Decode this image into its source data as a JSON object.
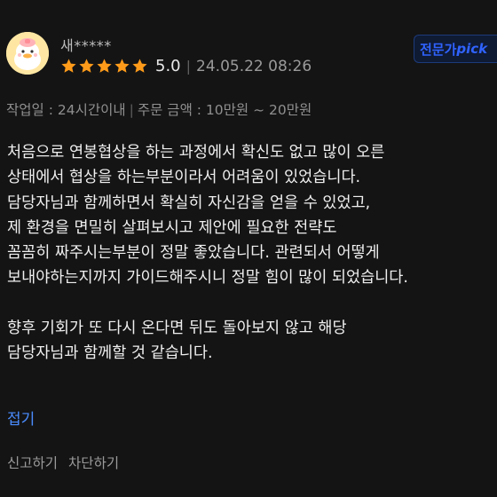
{
  "header": {
    "reviewer_name": "새*****",
    "rating_value": 5,
    "rating_text": "5.0",
    "date": "24.05.22 08:26",
    "badge": {
      "prefix": "전문가",
      "suffix": "pick"
    }
  },
  "meta": {
    "work_days": "작업일 : 24시간이내",
    "order_amount": "주문 금액 : 10만원 ~ 20만원"
  },
  "review": {
    "lines": [
      "처음으로 연봉협상을 하는 과정에서 확신도 없고 많이 오른",
      "상태에서 협상을 하는부분이라서 어려움이 있었습니다.",
      "담당자님과 함께하면서 확실히 자신감을 얻을 수 있었고,",
      "제 환경을 면밀히 살펴보시고 제안에 필요한 전략도",
      "꼼꼼히 짜주시는부분이 정말 좋았습니다. 관련되서 어떻게",
      "보내야하는지까지 가이드해주시니 정말 힘이 많이 되었습니다.",
      "",
      "향후 기회가 또 다시 온다면 뒤도 돌아보지 않고 해당",
      "담당자님과 함께할 것 같습니다."
    ],
    "fold_label": "접기"
  },
  "actions": {
    "report_label": "신고하기",
    "block_label": "차단하기"
  },
  "colors": {
    "background": "#141414",
    "star": "#ff9b1a",
    "link": "#4a8dff",
    "badge": "#2f63ff"
  }
}
